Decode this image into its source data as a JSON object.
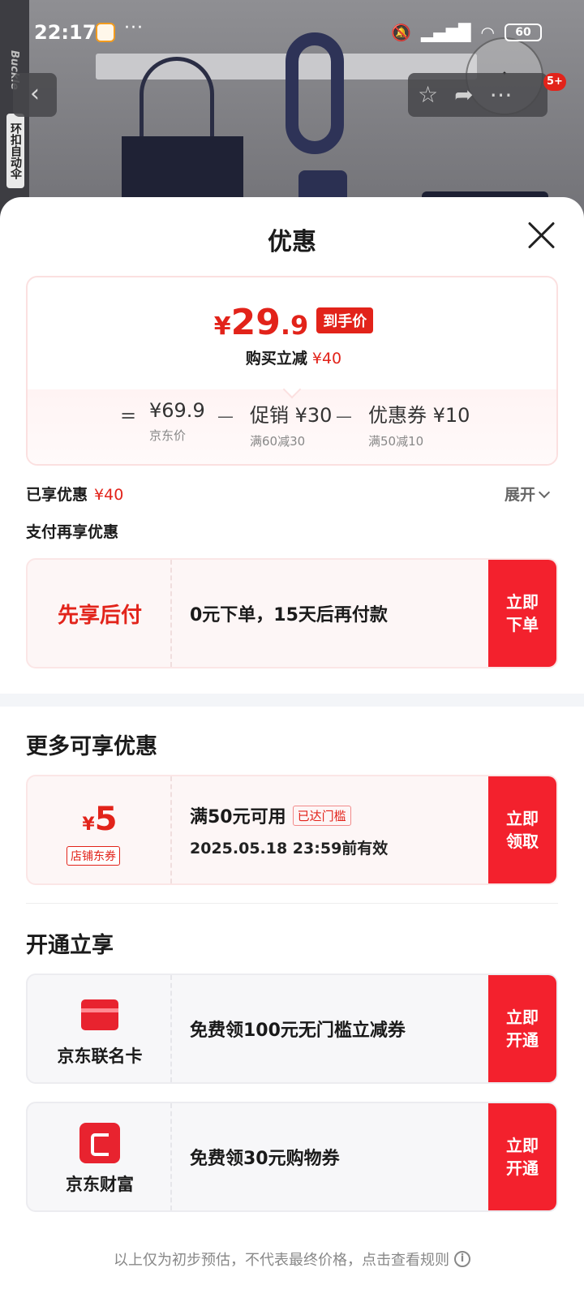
{
  "status_bar": {
    "time": "22:17",
    "dots": "···",
    "battery": "60",
    "icons": [
      "mute-icon",
      "hd-signal-icon",
      "wifi-icon",
      "battery-icon"
    ]
  },
  "backdrop": {
    "side_label": "环扣自动伞",
    "brand": "Buckle",
    "badge": "5+"
  },
  "sheet": {
    "title": "优惠",
    "price": {
      "symbol": "¥",
      "integer": "29",
      "decimal": ".9",
      "tag": "到手价",
      "reduce_label": "购买立减",
      "reduce_amount": "¥40"
    },
    "calc": {
      "equals": "=",
      "minus": "—",
      "items": [
        {
          "value": "¥69.9",
          "label": "京东价"
        },
        {
          "value": "促销 ¥30",
          "label": "满60减30"
        },
        {
          "value": "优惠券 ¥10",
          "label": "满50减10"
        }
      ]
    },
    "enjoyed": {
      "label": "已享优惠",
      "amount": "¥40",
      "expand": "展开"
    },
    "pay_title": "支付再享优惠",
    "bnpl": {
      "label": "先享后付",
      "text": "0元下单，15天后再付款",
      "button": "立即下单"
    },
    "more_title": "更多可享优惠",
    "coupon": {
      "symbol": "¥",
      "value": "5",
      "type": "店铺东券",
      "condition": "满50元可用",
      "threshold_tag": "已达门槛",
      "validity": "2025.05.18 23:59前有效",
      "button": "立即领取"
    },
    "open_title": "开通立享",
    "cobrand_card": {
      "name": "京东联名卡",
      "text": "免费领100元无门槛立减券",
      "button": "立即开通"
    },
    "wealth": {
      "name": "京东财富",
      "text": "免费领30元购物券",
      "button": "立即开通"
    },
    "footer": "以上仅为初步预估，不代表最终价格，点击查看规则",
    "accent_color": "#e2231a"
  }
}
